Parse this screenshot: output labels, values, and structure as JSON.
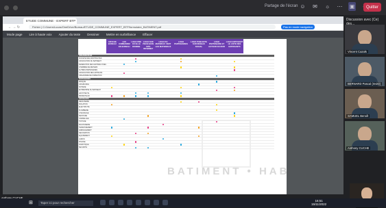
{
  "meeting": {
    "timer": "Partage de l'écran",
    "leave_label": "Quitter"
  },
  "browser": {
    "tab_title": "ETUDE COMMUNE - EXPERT BTP",
    "url": "Fichier | C:/Users/Lucas/OneDrive/Bureau/ETUDE_COMMUNE_EXPERT_BTP/formulaire_BATIMENT.pdf",
    "profile": "Pas en mode navigation"
  },
  "pdf_toolbar": [
    "Mode page",
    "Lire à haute voix",
    "Ajouter du texte",
    "Dessiner",
    "Mettre en surbrillance",
    "Effacer"
  ],
  "table": {
    "columns": [
      "AFFICHE BUREAU",
      "LES COMMANDES EN BUREAU",
      "LOGO PRE OU ELLE DOMINE",
      "LOGO SUR PIECE BOIS SITE INTERNET",
      "LOGO DU MATERIAU VERT LES MATERIAUX",
      "LOGO PARTENAIRES",
      "LOGO PUBLICITE SUR RESEAU SOCIAL",
      "LOGO PARTENAIRE ET AUTOUR DU MUR",
      "LOGO EXPOSANT LE LISTE DES EXPOSANTS"
    ],
    "sections": [
      {
        "title": "ORGANISATEUR",
        "rows": [
          "SOCIETE DES ARCHITECTES",
          "ASSOCIATION DU BATIMENT",
          "FEDERATION DES MAITRES D'OEUVRE",
          "CHAMBRE DE METIERS",
          "AUTRES PARTENAIRES",
          "ASSOCIATION DES ARTISANS",
          "ORGANISME DE FORMATION"
        ]
      },
      {
        "title": "PARTENAIRES",
        "rows": [
          "BANQUE",
          "ASSURANCE",
          "NOTAIRE",
          "ENTREPRISE DU BATIMENT",
          "ARCHITECTE",
          "PROMOTEUR"
        ]
      },
      {
        "title": "EXPOSANTS",
        "rows": [
          "MENUISERIE",
          "ISOLATION",
          "ELECTRICITE",
          "PLOMBERIE",
          "CHAUFFAGE",
          "PEINTURE",
          "CARRELAGE",
          "TOITURE",
          "MACONNERIE",
          "TERRASSEMENT",
          "AMENAGEMENT",
          "DECORATION",
          "EQUIPEMENT",
          "JARDIN",
          "PISCINE",
          "DOMOTIQUE",
          "SECURITE"
        ]
      }
    ],
    "watermark": "BATIMENT • HABITAT"
  },
  "participants": {
    "header": "Discussion avec (Ce) des...",
    "people": [
      {
        "name": "Vincent Cazals"
      },
      {
        "name": "BERNARD Pascal (Invité)"
      },
      {
        "name": "SAMUEL Benoît"
      },
      {
        "name": "Anthony CUCHE"
      }
    ]
  },
  "self_name": "Anthony CUCHE",
  "taskbar": {
    "search_placeholder": "Taper ici pour rechercher",
    "time": "16:51",
    "date": "15/11/2022"
  },
  "colors": {
    "header_purple": "#6d3fb3",
    "dot_pink": "#e5307c",
    "dot_blue": "#1aa3dd",
    "dot_orange": "#f39c12"
  }
}
